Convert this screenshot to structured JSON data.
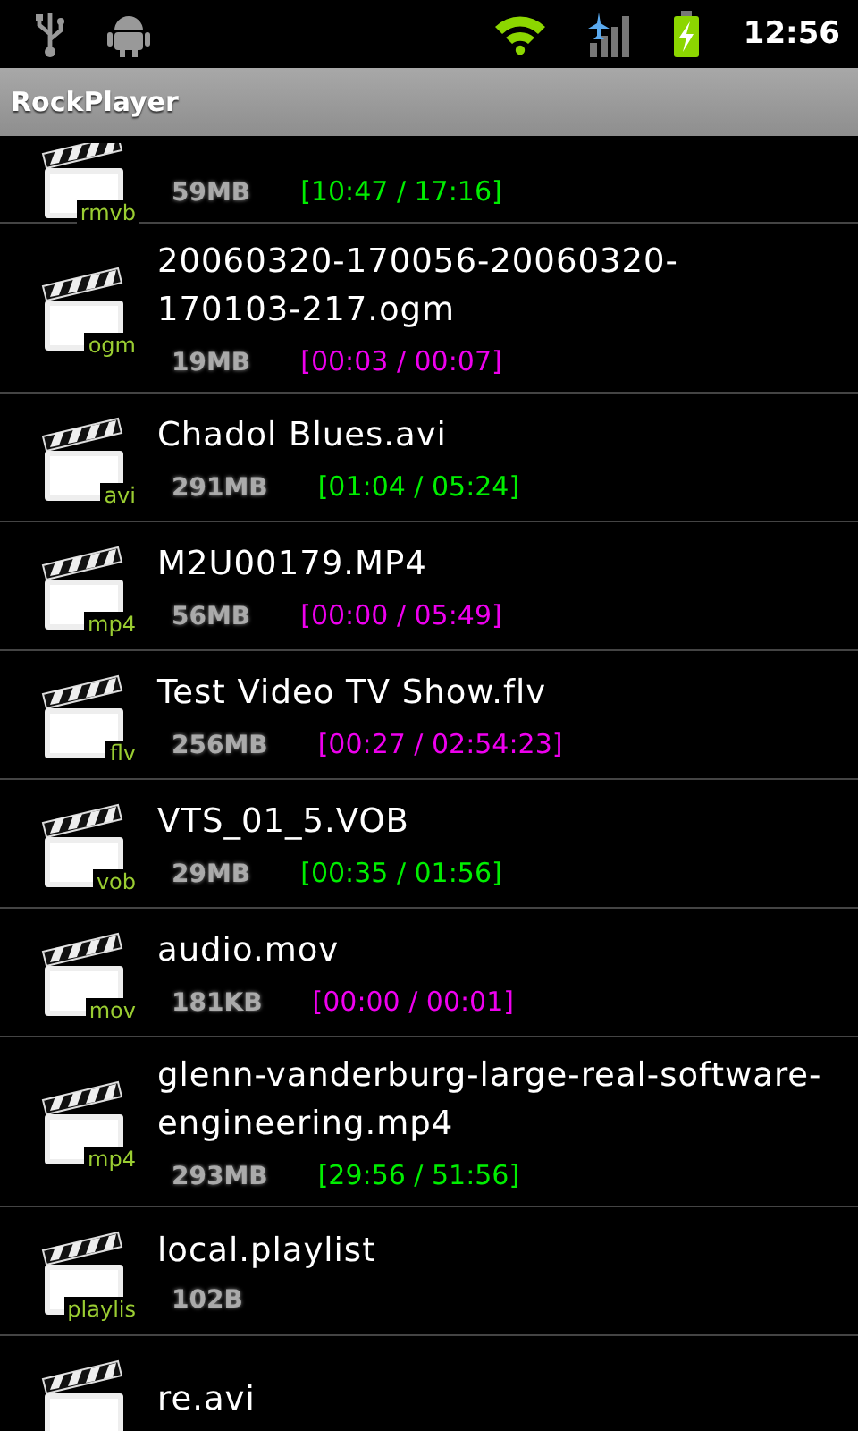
{
  "status_bar": {
    "time": "12:56"
  },
  "title_bar": {
    "title": "RockPlayer"
  },
  "files": [
    {
      "kind": "partial",
      "ext": "rmvb",
      "size": "59MB",
      "progress": "[10:47 / 17:16]",
      "color": "#00ee00"
    },
    {
      "kind": "file",
      "name": "20060320-170056-20060320-170103-217.ogm",
      "ext": "ogm",
      "size": "19MB",
      "progress": "[00:03 / 00:07]",
      "color": "#ee00ee"
    },
    {
      "kind": "file",
      "name": "Chadol Blues.avi",
      "ext": "avi",
      "size": "291MB",
      "progress": "[01:04 / 05:24]",
      "color": "#00ee00"
    },
    {
      "kind": "file",
      "name": "M2U00179.MP4",
      "ext": "mp4",
      "size": "56MB",
      "progress": "[00:00 / 05:49]",
      "color": "#ee00ee"
    },
    {
      "kind": "file",
      "name": "Test Video TV Show.flv",
      "ext": "flv",
      "size": "256MB",
      "progress": "[00:27 / 02:54:23]",
      "color": "#ee00ee"
    },
    {
      "kind": "file",
      "name": "VTS_01_5.VOB",
      "ext": "vob",
      "size": "29MB",
      "progress": "[00:35 / 01:56]",
      "color": "#00ee00"
    },
    {
      "kind": "file",
      "name": "audio.mov",
      "ext": "mov",
      "size": "181KB",
      "progress": "[00:00 / 00:01]",
      "color": "#ee00ee"
    },
    {
      "kind": "file",
      "name": "glenn-vanderburg-large-real-software-engineering.mp4",
      "ext": "mp4",
      "size": "293MB",
      "progress": "[29:56 / 51:56]",
      "color": "#00ee00"
    },
    {
      "kind": "file",
      "name": "local.playlist",
      "ext": "playlis",
      "size": "102B"
    },
    {
      "kind": "file",
      "name": "re.avi"
    }
  ]
}
